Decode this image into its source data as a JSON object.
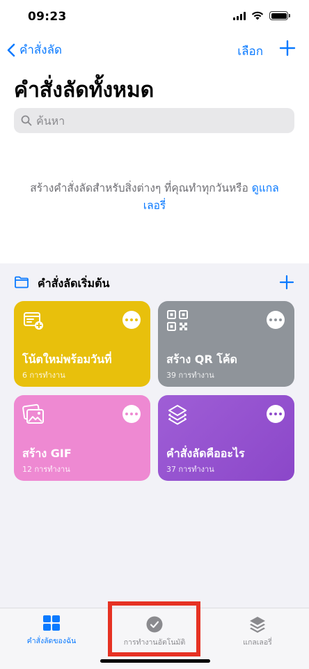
{
  "status": {
    "time": "09:23"
  },
  "nav": {
    "back_label": "คำสั่งลัด",
    "select_label": "เลือก"
  },
  "page": {
    "title": "คำสั่งลัดทั้งหมด"
  },
  "search": {
    "placeholder": "ค้นหา"
  },
  "empty_state": {
    "text": "สร้างคำสั่งลัดสำหรับสิ่งต่างๆ ที่คุณทำทุกวันหรือ ",
    "gallery_link": "ดูแกลเลอรี่"
  },
  "section": {
    "title": "คำสั่งลัดเริ่มต้น"
  },
  "tiles": [
    {
      "title": "โน้ตใหม่พร้อมวันที่",
      "count": "6 การทำงาน",
      "icon": "note-add-icon",
      "color": "#e8c00c"
    },
    {
      "title": "สร้าง QR โค้ด",
      "count": "39 การทำงาน",
      "icon": "qr-code-icon",
      "color": "#8f949a"
    },
    {
      "title": "สร้าง GIF",
      "count": "12 การทำงาน",
      "icon": "photos-icon",
      "color": "#ee89d2"
    },
    {
      "title": "คำสั่งลัดคืออะไร",
      "count": "37 การทำงาน",
      "icon": "layers-icon",
      "color": "#9a57d3"
    }
  ],
  "tabs": [
    {
      "label": "คำสั่งลัดของฉัน",
      "icon": "grid-icon",
      "active": true
    },
    {
      "label": "การทำงานอัตโนมัติ",
      "icon": "clock-check-icon",
      "active": false
    },
    {
      "label": "แกลเลอรี่",
      "icon": "stack-icon",
      "active": false
    }
  ],
  "colors": {
    "accent": "#0a7aff",
    "highlight": "#e63223"
  }
}
